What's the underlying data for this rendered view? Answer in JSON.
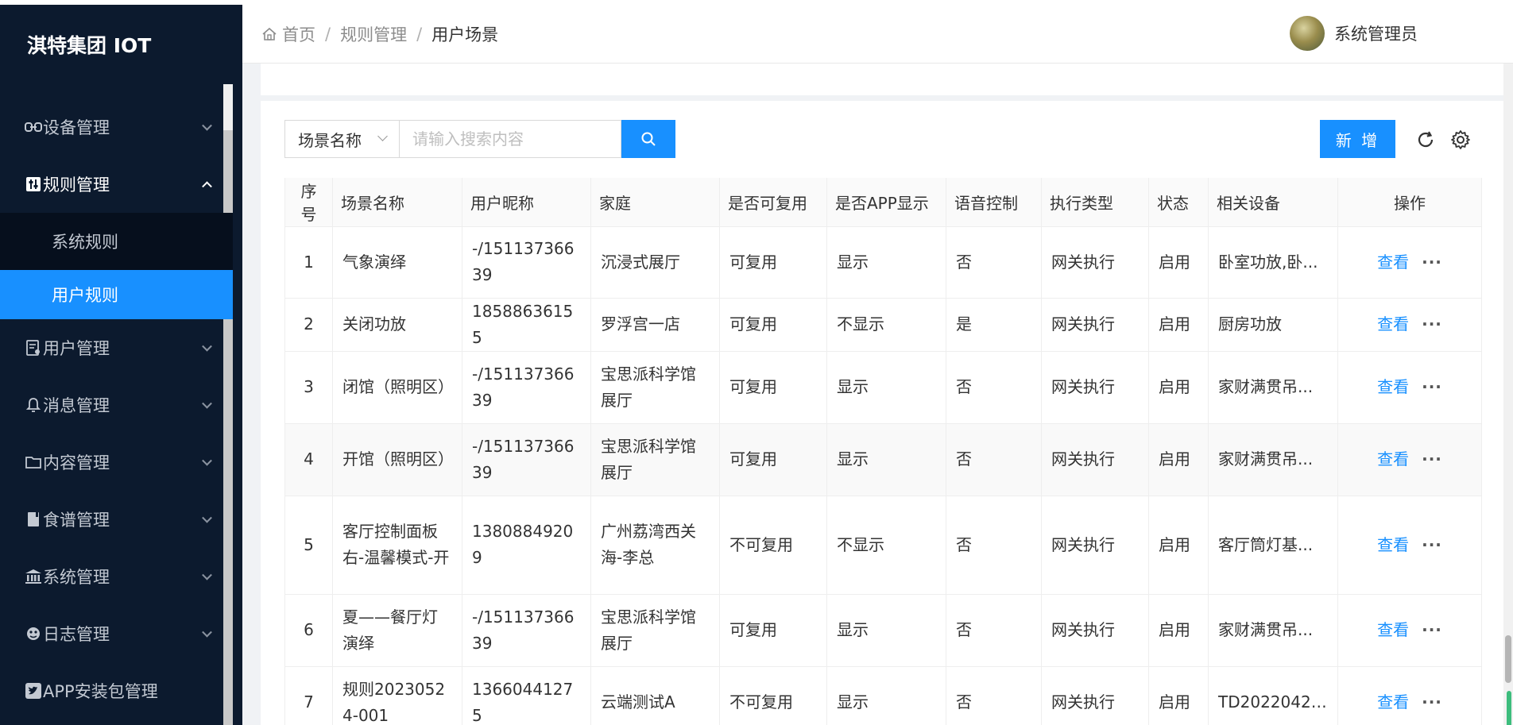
{
  "app": {
    "title": "淇特集团 IOT"
  },
  "sidebar": {
    "items": [
      {
        "label": "设备管理",
        "icon": "link-icon"
      },
      {
        "label": "规则管理",
        "icon": "sliders-icon",
        "open": true,
        "children": [
          {
            "label": "系统规则"
          },
          {
            "label": "用户规则",
            "active": true
          }
        ]
      },
      {
        "label": "用户管理",
        "icon": "user-list-icon"
      },
      {
        "label": "消息管理",
        "icon": "bell-icon"
      },
      {
        "label": "内容管理",
        "icon": "folder-icon"
      },
      {
        "label": "食谱管理",
        "icon": "book-icon"
      },
      {
        "label": "系统管理",
        "icon": "bank-icon"
      },
      {
        "label": "日志管理",
        "icon": "bug-icon"
      },
      {
        "label": "APP安装包管理",
        "icon": "twitter-icon"
      }
    ]
  },
  "header": {
    "breadcrumb": [
      "首页",
      "规则管理",
      "用户场景"
    ],
    "user_name": "系统管理员"
  },
  "toolbar": {
    "field_select": "场景名称",
    "search_placeholder": "请输入搜索内容",
    "add_label": "新 增"
  },
  "table": {
    "columns": [
      "序号",
      "场景名称",
      "用户昵称",
      "家庭",
      "是否可复用",
      "是否APP显示",
      "语音控制",
      "执行类型",
      "状态",
      "相关设备",
      "操作"
    ],
    "rows": [
      [
        "1",
        "气象演绎",
        "-/15113736639",
        "沉浸式展厅",
        "可复用",
        "显示",
        "否",
        "网关执行",
        "启用",
        "卧室功放,卧..."
      ],
      [
        "2",
        "关闭功放",
        "18588636155",
        "罗浮宫一店",
        "可复用",
        "不显示",
        "是",
        "网关执行",
        "启用",
        "厨房功放"
      ],
      [
        "3",
        "闭馆（照明区）",
        "-/15113736639",
        "宝思派科学馆展厅",
        "可复用",
        "显示",
        "否",
        "网关执行",
        "启用",
        "家财满贯吊..."
      ],
      [
        "4",
        "开馆（照明区）",
        "-/15113736639",
        "宝思派科学馆展厅",
        "可复用",
        "显示",
        "否",
        "网关执行",
        "启用",
        "家财满贯吊..."
      ],
      [
        "5",
        "客厅控制面板右-温馨模式-开",
        "13808849209",
        "广州荔湾西关海-李总",
        "不可复用",
        "不显示",
        "否",
        "网关执行",
        "启用",
        "客厅筒灯基..."
      ],
      [
        "6",
        "夏——餐厅灯演绎",
        "-/15113736639",
        "宝思派科学馆展厅",
        "可复用",
        "显示",
        "否",
        "网关执行",
        "启用",
        "家财满贯吊..."
      ],
      [
        "7",
        "规则20230524-001",
        "13660441275",
        "云端测试A",
        "不可复用",
        "显示",
        "否",
        "网关执行",
        "启用",
        "TD20220422..."
      ]
    ],
    "action_view": "查看",
    "action_more": "···"
  }
}
